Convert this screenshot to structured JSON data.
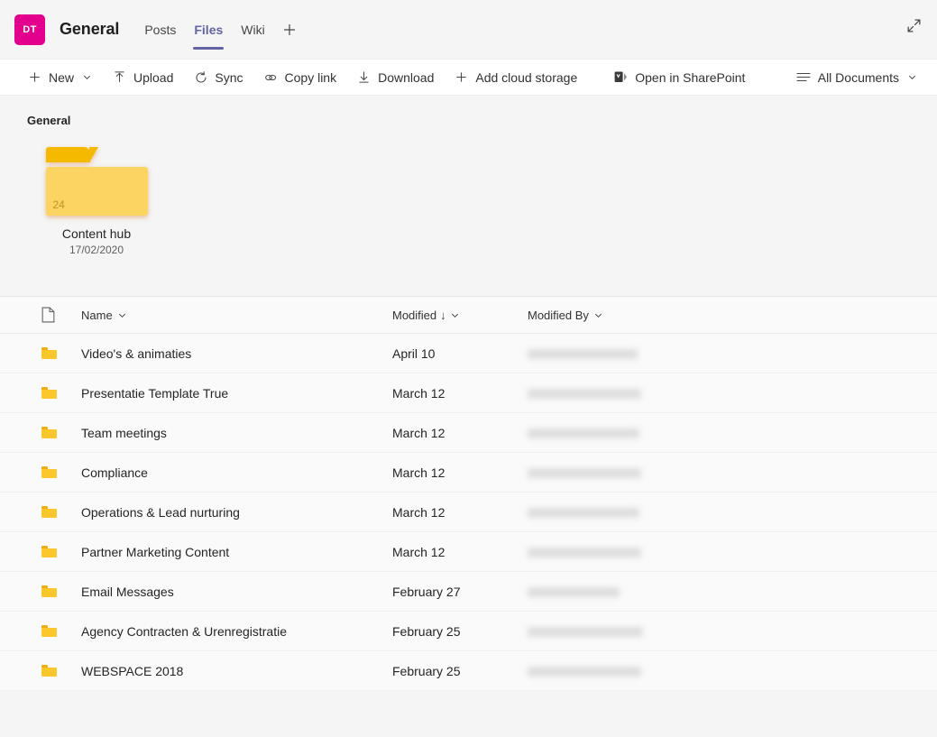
{
  "header": {
    "avatar_initials": "DT",
    "avatar_color": "#e3008c",
    "team_title": "General",
    "accent_color": "#6264a7",
    "expand_icon": "expand-diagonal-icon",
    "tabs": [
      {
        "label": "Posts",
        "active": false
      },
      {
        "label": "Files",
        "active": true
      },
      {
        "label": "Wiki",
        "active": false
      }
    ],
    "add_tab_label": "+"
  },
  "commandbar": {
    "items": [
      {
        "label": "New",
        "icon": "plus-icon",
        "chevron": true
      },
      {
        "label": "Upload",
        "icon": "upload-icon",
        "chevron": false
      },
      {
        "label": "Sync",
        "icon": "sync-icon",
        "chevron": false
      },
      {
        "label": "Copy link",
        "icon": "link-icon",
        "chevron": false
      },
      {
        "label": "Download",
        "icon": "download-icon",
        "chevron": false
      },
      {
        "label": "Add cloud storage",
        "icon": "plus-icon",
        "chevron": false
      },
      {
        "label": "Open in SharePoint",
        "icon": "sharepoint-icon",
        "chevron": false
      }
    ],
    "view_selector": {
      "label": "All Documents",
      "icon": "list-view-icon",
      "chevron": true
    }
  },
  "breadcrumb": {
    "label": "General"
  },
  "tile": {
    "name": "Content hub",
    "date": "17/02/2020",
    "count": "24",
    "icon": "folder-icon",
    "folder_color": "#fcd462",
    "folder_tab_color": "#f5ba00"
  },
  "table": {
    "columns": {
      "icon": "file-type-icon",
      "name": "Name",
      "modified": "Modified",
      "modified_by": "Modified By"
    },
    "sort": {
      "column": "Modified",
      "direction": "descending",
      "arrow": "↓"
    },
    "rows": [
      {
        "icon": "folder-icon",
        "name": "Video's & animaties",
        "modified": "April 10",
        "modified_by_redacted_width": 122
      },
      {
        "icon": "folder-icon",
        "name": "Presentatie Template True",
        "modified": "March 12",
        "modified_by_redacted_width": 126
      },
      {
        "icon": "folder-icon",
        "name": "Team meetings",
        "modified": "March 12",
        "modified_by_redacted_width": 124
      },
      {
        "icon": "folder-icon",
        "name": "Compliance",
        "modified": "March 12",
        "modified_by_redacted_width": 126
      },
      {
        "icon": "folder-icon",
        "name": "Operations & Lead nurturing",
        "modified": "March 12",
        "modified_by_redacted_width": 124
      },
      {
        "icon": "folder-icon",
        "name": "Partner Marketing Content",
        "modified": "March 12",
        "modified_by_redacted_width": 126
      },
      {
        "icon": "folder-icon",
        "name": "Email Messages",
        "modified": "February 27",
        "modified_by_redacted_width": 102
      },
      {
        "icon": "folder-icon",
        "name": "Agency Contracten & Urenregistratie",
        "modified": "February 25",
        "modified_by_redacted_width": 128
      },
      {
        "icon": "folder-icon",
        "name": "WEBSPACE 2018",
        "modified": "February 25",
        "modified_by_redacted_width": 126
      }
    ]
  }
}
